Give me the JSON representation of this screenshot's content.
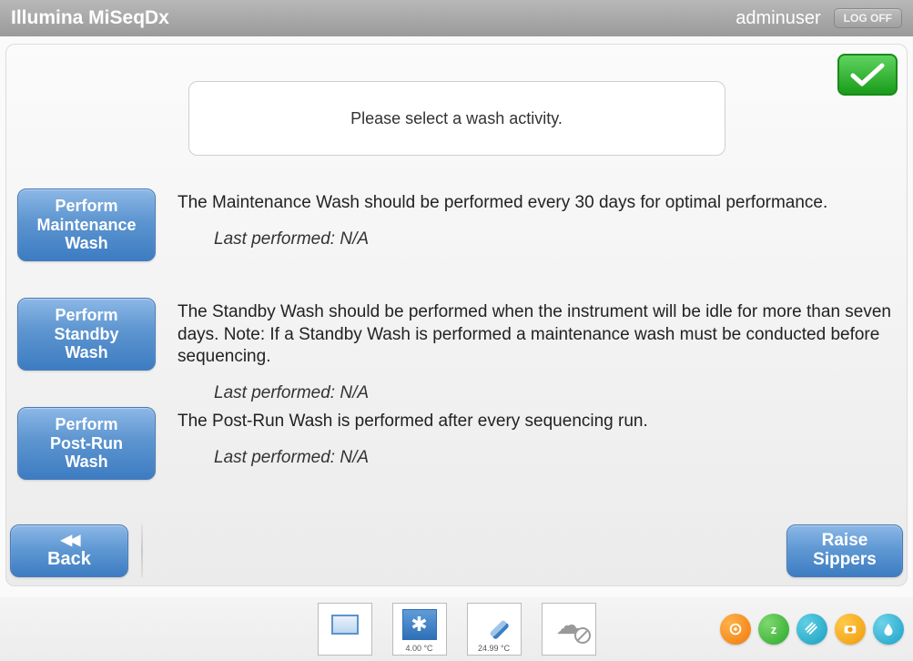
{
  "header": {
    "title": "Illumina MiSeqDx",
    "user": "adminuser",
    "logoff": "LOG OFF"
  },
  "prompt": "Please select a wash activity.",
  "wash": {
    "maintenance": {
      "button": "Perform\nMaintenance\nWash",
      "desc": "The Maintenance Wash should be performed every 30 days for optimal performance.",
      "last": "Last performed: N/A"
    },
    "standby": {
      "button": "Perform\nStandby\nWash",
      "desc": "The Standby Wash should be performed when the instrument will be idle for more than seven days. Note: If a Standby Wash is performed a maintenance wash must be conducted before sequencing.",
      "last": "Last performed: N/A"
    },
    "postrun": {
      "button": "Perform\nPost-Run\nWash",
      "desc": "The Post-Run Wash is performed after every sequencing run.",
      "last": "Last performed: N/A"
    }
  },
  "nav": {
    "back": "Back",
    "raise": "Raise\nSippers"
  },
  "footer": {
    "chiller_temp": "4.00 °C",
    "flowcell_temp": "24.99 °C"
  }
}
